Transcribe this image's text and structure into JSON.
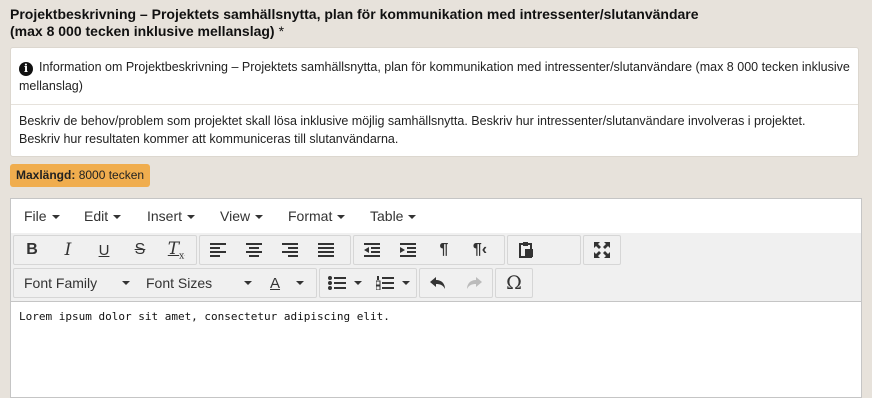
{
  "field": {
    "title_line1": "Projektbeskrivning – Projektets samhällsnytta, plan för kommunikation med intressenter/slutanvändare",
    "title_line2": "(max 8 000 tecken inklusive mellanslag)",
    "required_marker": "*"
  },
  "info": {
    "icon": "info-circle-icon",
    "heading": "Information om Projektbeskrivning – Projektets samhällsnytta, plan för kommunikation med intressenter/slutanvändare (max 8 000 tecken inklusive mellanslag)",
    "description": "Beskriv de behov/problem som projektet skall lösa inklusive möjlig samhällsnytta. Beskriv hur intressenter/slutanvändare involveras i projektet. Beskriv hur resultaten kommer att kommuniceras till slutanvändarna."
  },
  "maxlength": {
    "label": "Maxlängd:",
    "value": "8000 tecken",
    "color": "#f0ad4e"
  },
  "editor": {
    "menus": [
      "File",
      "Edit",
      "Insert",
      "View",
      "Format",
      "Table"
    ],
    "font_family_label": "Font Family",
    "font_sizes_label": "Font Sizes",
    "content": "Lorem ipsum dolor sit amet, consectetur adipiscing elit."
  }
}
